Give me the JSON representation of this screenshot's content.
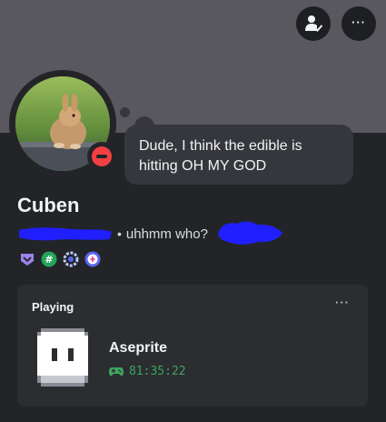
{
  "banner": {
    "color": "#58585e"
  },
  "actions": {
    "add_friend_icon": "person-check-icon",
    "more_icon": "more-dots-icon",
    "more_glyph": "···"
  },
  "avatar": {
    "status": "do-not-disturb",
    "status_color": "#f23f43"
  },
  "custom_status": {
    "line1": "Dude, I think the edible is",
    "line2": "hitting OH MY GOD"
  },
  "profile": {
    "display_name": "Cuben",
    "separator": "•",
    "pronouns_visible": "uhhmm who?",
    "redaction_color": "#1f1fff"
  },
  "badges": [
    "hypesquad-icon",
    "hashtag-icon",
    "nitro-gear-icon",
    "quest-icon"
  ],
  "activity": {
    "header": "Playing",
    "menu_glyph": "···",
    "game": "Aseprite",
    "elapsed": "81:35:22",
    "elapsed_icon": "gamepad-icon",
    "accent_color": "#3ba55d"
  }
}
